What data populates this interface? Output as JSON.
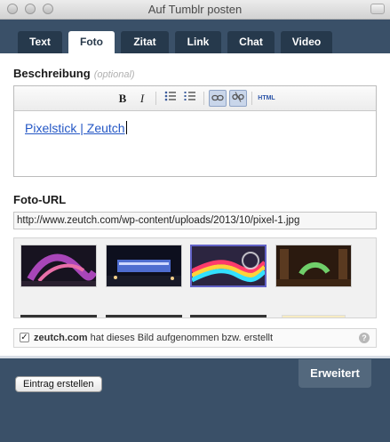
{
  "window": {
    "title": "Auf Tumblr posten"
  },
  "tabs": [
    {
      "label": "Text"
    },
    {
      "label": "Foto"
    },
    {
      "label": "Zitat"
    },
    {
      "label": "Link"
    },
    {
      "label": "Chat"
    },
    {
      "label": "Video"
    }
  ],
  "active_tab": "Foto",
  "description": {
    "label": "Beschreibung",
    "optional": "(optional)",
    "toolbar": {
      "bold": "B",
      "italic": "I",
      "html": "HTML"
    },
    "text": "Pixelstick | Zeutch"
  },
  "photo_url": {
    "label": "Foto-URL",
    "value": "http://www.zeutch.com/wp-content/uploads/2013/10/pixel-1.jpg"
  },
  "gallery": {
    "selected_index": 2
  },
  "source": {
    "site": "zeutch.com",
    "text": "hat dieses Bild aufgenommen bzw. erstellt",
    "help": "?"
  },
  "footer": {
    "create_label": "Eintrag erstellen",
    "advanced_label": "Erweitert"
  }
}
